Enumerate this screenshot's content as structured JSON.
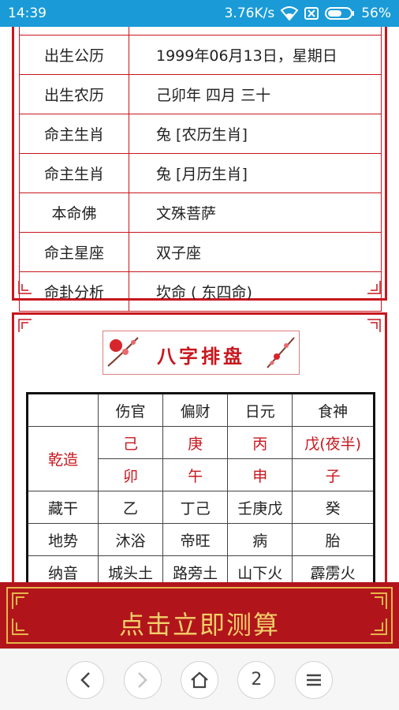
{
  "status_bar": {
    "time": "14:39",
    "network_speed": "3.76K/s",
    "battery": "56%"
  },
  "info_table": [
    {
      "label": "出生公历",
      "value": "1999年06月13日，星期日"
    },
    {
      "label": "出生农历",
      "value": "己卯年 四月 三十"
    },
    {
      "label": "命主生肖",
      "value": "兔 [农历生肖]"
    },
    {
      "label": "命主生肖",
      "value": "兔 [月历生肖]"
    },
    {
      "label": "本命佛",
      "value": "文殊菩萨"
    },
    {
      "label": "命主星座",
      "value": "双子座"
    },
    {
      "label": "命卦分析",
      "value": "坎命 ( 东四命)"
    }
  ],
  "bazi": {
    "banner_title": "八字排盘",
    "headers": [
      "",
      "伤官",
      "偏财",
      "日元",
      "食神"
    ],
    "qianzao_label": "乾造",
    "stems": [
      "己",
      "庚",
      "丙",
      "戊(夜半)"
    ],
    "branches": [
      "卯",
      "午",
      "申",
      "子"
    ],
    "rows": [
      {
        "label": "藏干",
        "cells": [
          "乙",
          "丁己",
          "壬庚戊",
          "癸"
        ]
      },
      {
        "label": "地势",
        "cells": [
          "沐浴",
          "帝旺",
          "病",
          "胎"
        ]
      },
      {
        "label": "纳音",
        "cells": [
          "城头土",
          "路旁土",
          "山下火",
          "霹雳火"
        ]
      }
    ]
  },
  "cta": {
    "label": "点击立即测算"
  },
  "nav": {
    "back_icon": "chevron-left",
    "forward_icon": "chevron-right",
    "home_icon": "home",
    "tabs_count": "2",
    "menu_icon": "hamburger"
  },
  "colors": {
    "status_bar": "#1a9bd7",
    "frame_red": "#c8161d",
    "cta_bg": "#b1151b",
    "cta_text": "#f4d06a"
  }
}
